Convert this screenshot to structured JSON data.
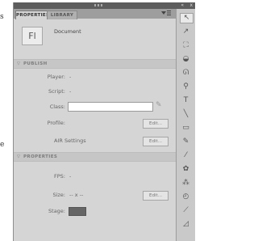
{
  "background": {
    "fragments": [
      "s",
      "e"
    ]
  },
  "window": {
    "chrome_glyphs": {
      "collapse": "«",
      "close": "x"
    }
  },
  "tabs": [
    {
      "label": "PROPERTIES",
      "active": true
    },
    {
      "label": "LIBRARY",
      "active": false
    }
  ],
  "panel_menu_icon": "panel-menu-icon",
  "document": {
    "icon_text": "Fl",
    "label": "Document"
  },
  "publish": {
    "section_title": "PUBLISH",
    "player_label": "Player:",
    "player_value": "-",
    "script_label": "Script:",
    "script_value": "-",
    "class_label": "Class:",
    "class_value": "",
    "profile_label": "Profile:",
    "profile_button": "Edit...",
    "air_label": "AIR Settings",
    "air_button": "Edit..."
  },
  "properties": {
    "section_title": "PROPERTIES",
    "fps_label": "FPS:",
    "fps_value": "-",
    "size_label": "Size:",
    "size_value": "-- x --",
    "size_button": "Edit...",
    "stage_label": "Stage:",
    "stage_color": "#666666"
  },
  "tools": [
    {
      "name": "selection-tool-icon",
      "glyph": "↖",
      "selected": true
    },
    {
      "name": "subselection-tool-icon",
      "glyph": "↗",
      "selected": false
    },
    {
      "name": "free-transform-tool-icon",
      "glyph": "⛶",
      "selected": false
    },
    {
      "name": "3d-rotation-tool-icon",
      "glyph": "◒",
      "selected": false
    },
    {
      "name": "lasso-tool-icon",
      "glyph": "ᘏ",
      "selected": false
    },
    {
      "name": "pen-tool-icon",
      "glyph": "⚲",
      "selected": false
    },
    {
      "name": "text-tool-icon",
      "glyph": "T",
      "selected": false
    },
    {
      "name": "line-tool-icon",
      "glyph": "╲",
      "selected": false
    },
    {
      "name": "rectangle-tool-icon",
      "glyph": "▭",
      "selected": false
    },
    {
      "name": "pencil-tool-icon",
      "glyph": "✎",
      "selected": false
    },
    {
      "name": "brush-tool-icon",
      "glyph": "⁄",
      "selected": false
    },
    {
      "name": "deco-tool-icon",
      "glyph": "✿",
      "selected": false
    },
    {
      "name": "bone-tool-icon",
      "glyph": "⁂",
      "selected": false
    },
    {
      "name": "paint-bucket-tool-icon",
      "glyph": "◴",
      "selected": false
    },
    {
      "name": "eyedropper-tool-icon",
      "glyph": "⟋",
      "selected": false
    },
    {
      "name": "eraser-tool-icon",
      "glyph": "◿",
      "selected": false
    }
  ]
}
